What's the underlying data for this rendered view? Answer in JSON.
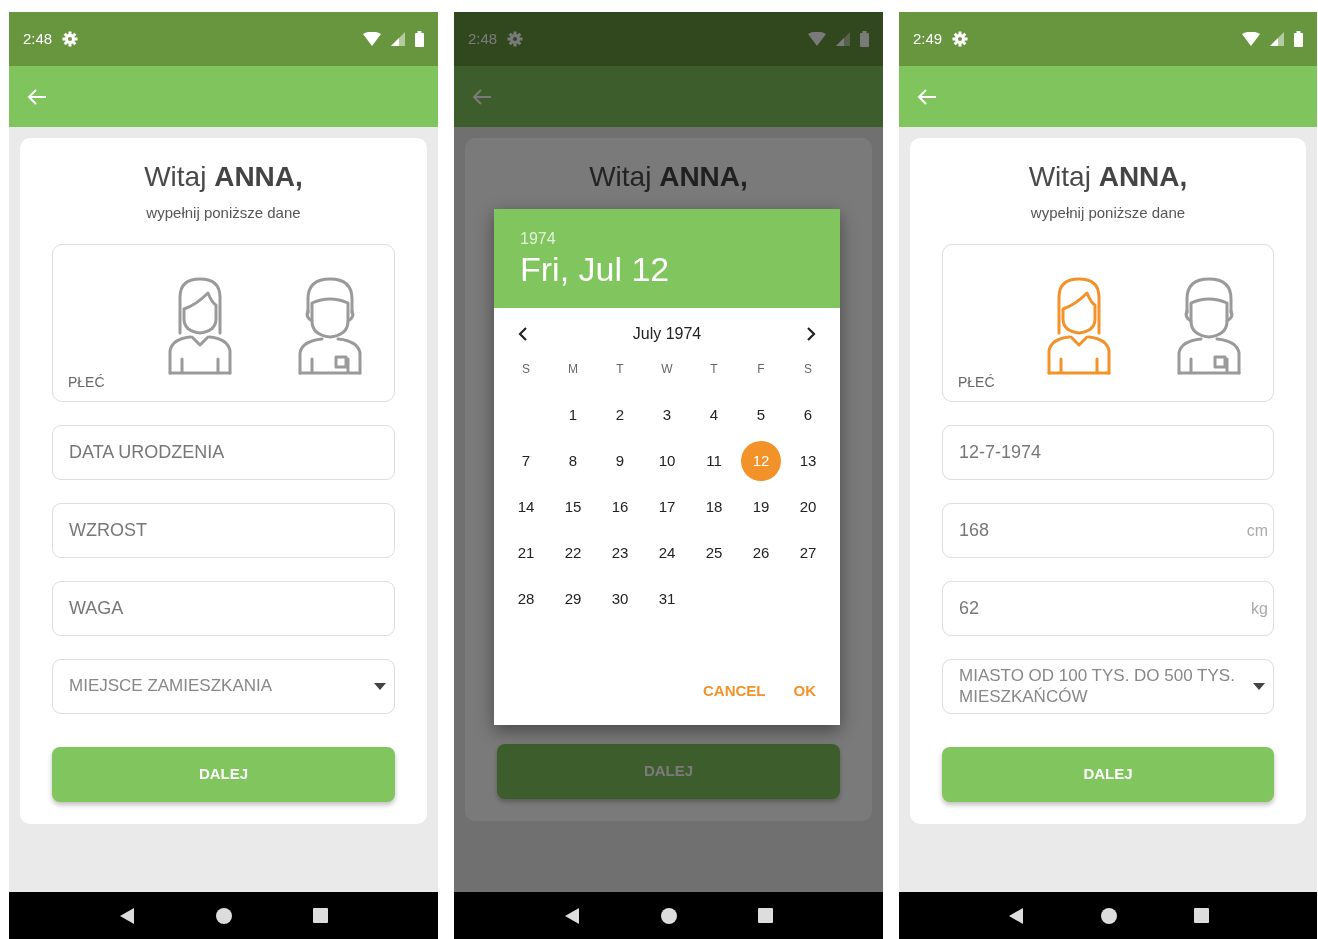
{
  "screens": [
    {
      "time": "2:48",
      "dimmed": false,
      "greeting": "Witaj **ANNA,**",
      "subtitle": "wypełnij poniższe dane",
      "gender": {
        "label": "PŁEĆ",
        "options": [
          {
            "kind": "female",
            "selected": false
          },
          {
            "kind": "male",
            "selected": false
          }
        ]
      },
      "fields": [
        {
          "kind": "text",
          "placeholder": "DATA URODZENIA"
        },
        {
          "kind": "text",
          "placeholder": "WZROST"
        },
        {
          "kind": "text",
          "placeholder": "WAGA"
        },
        {
          "kind": "select",
          "placeholder": "MIEJSCE ZAMIESZKANIA"
        }
      ],
      "button": "DALEJ"
    },
    {
      "time": "2:48",
      "dimmed": true,
      "greeting": "Witaj **ANNA,**",
      "button": "DALEJ",
      "date_picker": {
        "year": "1974",
        "date": "Fri, Jul 12",
        "month": "July 1974",
        "weekdays": [
          "S",
          "M",
          "T",
          "W",
          "T",
          "F",
          "S"
        ],
        "weeks": [
          [
            {
              "label": "1",
              "selected": false
            },
            {
              "label": "2",
              "selected": false
            },
            {
              "label": "3",
              "selected": false
            },
            {
              "label": "4",
              "selected": false
            },
            {
              "label": "5",
              "selected": false
            },
            {
              "label": "6",
              "selected": false
            }
          ],
          [
            {
              "label": "7",
              "selected": false
            },
            {
              "label": "8",
              "selected": false
            },
            {
              "label": "9",
              "selected": false
            },
            {
              "label": "10",
              "selected": false
            },
            {
              "label": "11",
              "selected": false
            },
            {
              "label": "12",
              "selected": true
            },
            {
              "label": "13",
              "selected": false
            }
          ],
          [
            {
              "label": "14",
              "selected": false
            },
            {
              "label": "15",
              "selected": false
            },
            {
              "label": "16",
              "selected": false
            },
            {
              "label": "17",
              "selected": false
            },
            {
              "label": "18",
              "selected": false
            },
            {
              "label": "19",
              "selected": false
            },
            {
              "label": "20",
              "selected": false
            }
          ],
          [
            {
              "label": "21",
              "selected": false
            },
            {
              "label": "22",
              "selected": false
            },
            {
              "label": "23",
              "selected": false
            },
            {
              "label": "24",
              "selected": false
            },
            {
              "label": "25",
              "selected": false
            },
            {
              "label": "26",
              "selected": false
            },
            {
              "label": "27",
              "selected": false
            }
          ],
          [
            {
              "label": "28",
              "selected": false
            },
            {
              "label": "29",
              "selected": false
            },
            {
              "label": "30",
              "selected": false
            },
            {
              "label": "31",
              "selected": false
            }
          ]
        ],
        "actions": [
          "CANCEL",
          "OK"
        ]
      }
    },
    {
      "time": "2:49",
      "dimmed": false,
      "greeting": "Witaj **ANNA,**",
      "subtitle": "wypełnij poniższe dane",
      "gender": {
        "label": "PŁEĆ",
        "options": [
          {
            "kind": "female",
            "selected": true
          },
          {
            "kind": "male",
            "selected": false
          }
        ]
      },
      "fields": [
        {
          "kind": "text",
          "value": "12-7-1974"
        },
        {
          "kind": "text",
          "value": "168",
          "unit": "cm"
        },
        {
          "kind": "text",
          "value": "62",
          "unit": "kg"
        },
        {
          "kind": "select",
          "value": "MIASTO OD 100 TYS. DO 500 TYS. MIESZKAŃCÓW"
        }
      ],
      "button": "DALEJ"
    }
  ]
}
